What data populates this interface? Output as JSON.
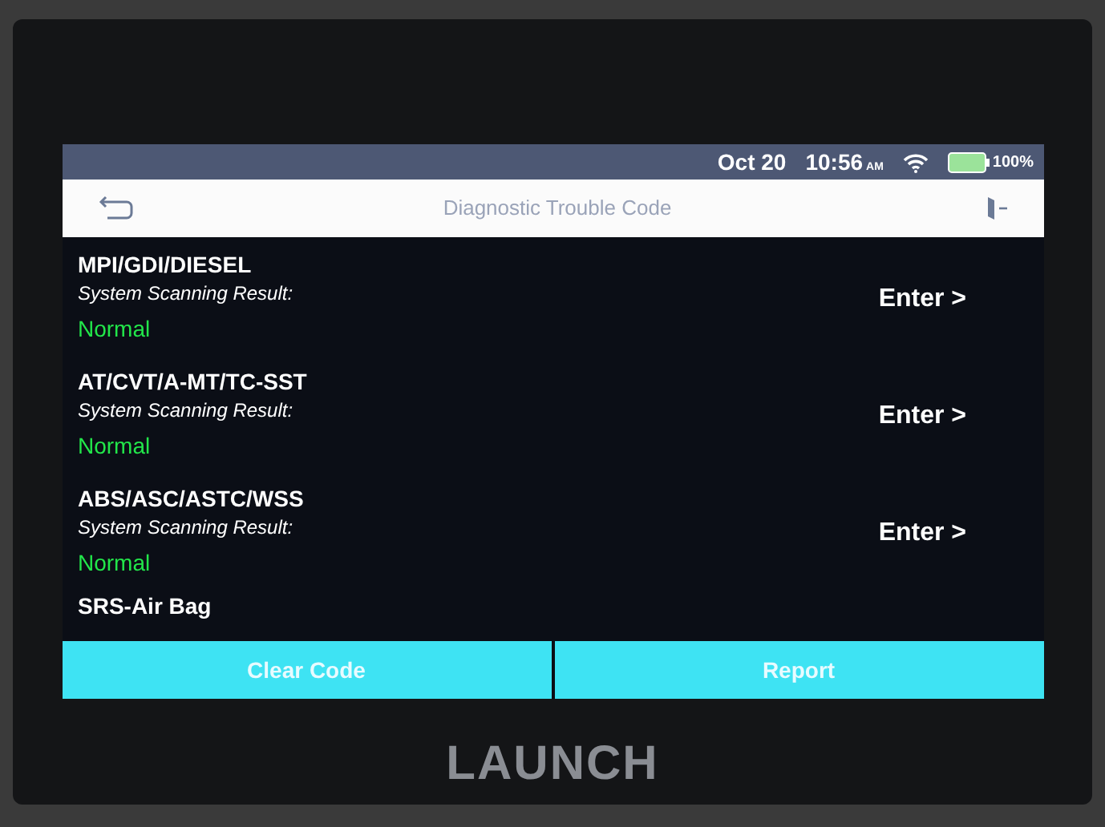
{
  "status_bar": {
    "date": "Oct 20",
    "time": "10:56",
    "ampm": "AM",
    "battery": "100%"
  },
  "title_bar": {
    "title": "Diagnostic Trouble Code"
  },
  "systems": [
    {
      "name": "MPI/GDI/DIESEL",
      "label": "System Scanning Result:",
      "result": "Normal",
      "action": "Enter >"
    },
    {
      "name": "AT/CVT/A-MT/TC-SST",
      "label": "System Scanning Result:",
      "result": "Normal",
      "action": "Enter >"
    },
    {
      "name": "ABS/ASC/ASTC/WSS",
      "label": "System Scanning Result:",
      "result": "Normal",
      "action": "Enter >"
    },
    {
      "name": "SRS-Air Bag"
    }
  ],
  "buttons": [
    "Clear Code",
    "Report"
  ],
  "brand": "LAUNCH"
}
